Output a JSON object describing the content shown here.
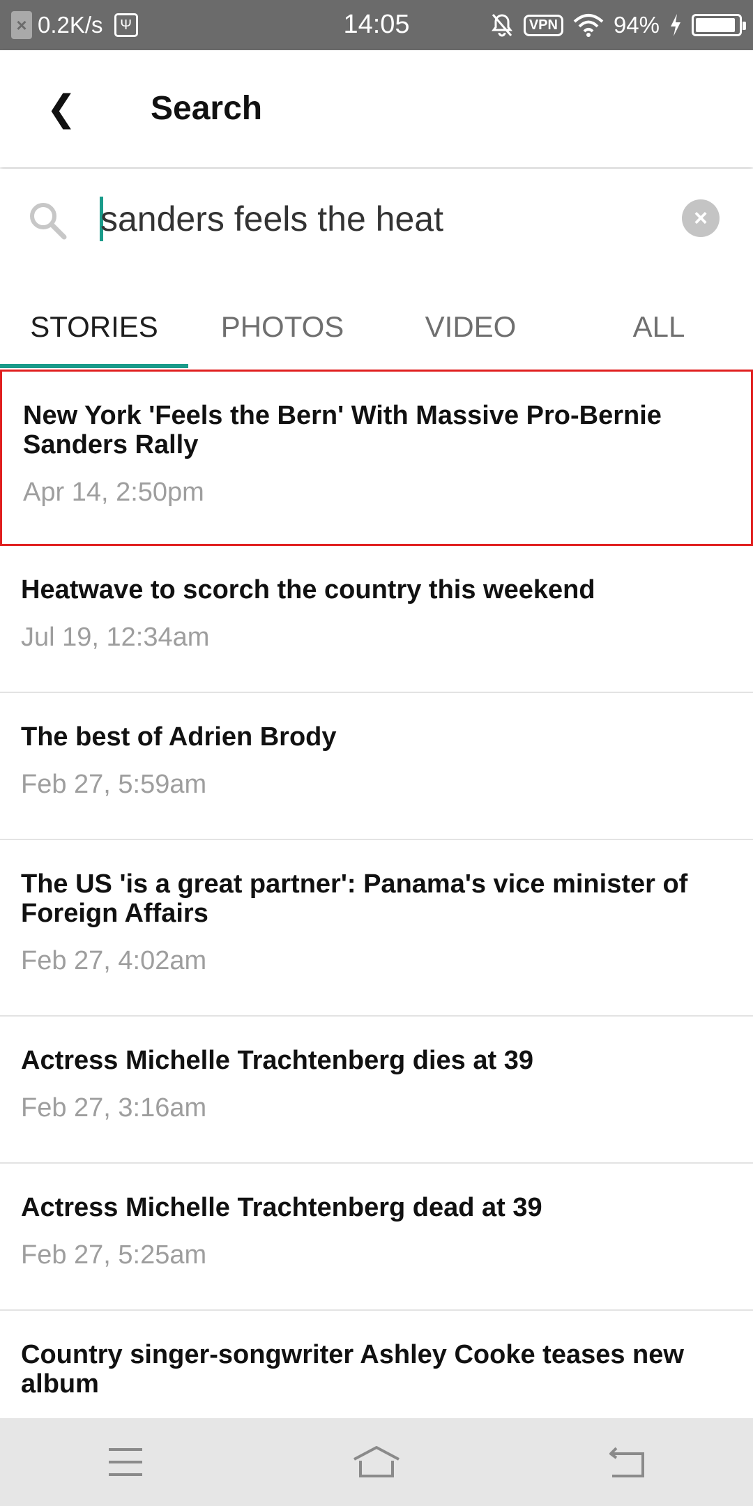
{
  "status_bar": {
    "net_speed": "0.2K/s",
    "time": "14:05",
    "vpn_label": "VPN",
    "battery_percent": "94%",
    "battery_level": 0.94
  },
  "header": {
    "title": "Search",
    "back_icon": "back-chevron-icon"
  },
  "search": {
    "query": "sanders feels the heat",
    "search_icon": "search-icon",
    "clear_icon": "clear-icon",
    "accent_color": "#1a9b8a"
  },
  "tabs": [
    {
      "label": "STORIES",
      "active": true
    },
    {
      "label": "PHOTOS",
      "active": false
    },
    {
      "label": "VIDEO",
      "active": false
    },
    {
      "label": "ALL",
      "active": false
    }
  ],
  "stories": [
    {
      "title": "New York 'Feels the Bern' With Massive Pro-Bernie Sanders Rally",
      "time": "Apr 14, 2:50pm",
      "highlighted": true
    },
    {
      "title": "Heatwave to scorch the country this weekend",
      "time": "Jul 19, 12:34am"
    },
    {
      "title": "The best of Adrien Brody",
      "time": "Feb 27, 5:59am"
    },
    {
      "title": "The US 'is a great partner': Panama's vice minister of Foreign Affairs",
      "time": "Feb 27, 4:02am"
    },
    {
      "title": "Actress Michelle Trachtenberg dies at 39",
      "time": "Feb 27, 3:16am"
    },
    {
      "title": "Actress Michelle Trachtenberg dead at 39",
      "time": "Feb 27, 5:25am"
    },
    {
      "title": "Country singer-songwriter Ashley Cooke teases new album",
      "time": ""
    }
  ],
  "nav_bar": {
    "menu_icon": "menu-icon",
    "home_icon": "home-icon",
    "back_icon": "back-icon"
  }
}
